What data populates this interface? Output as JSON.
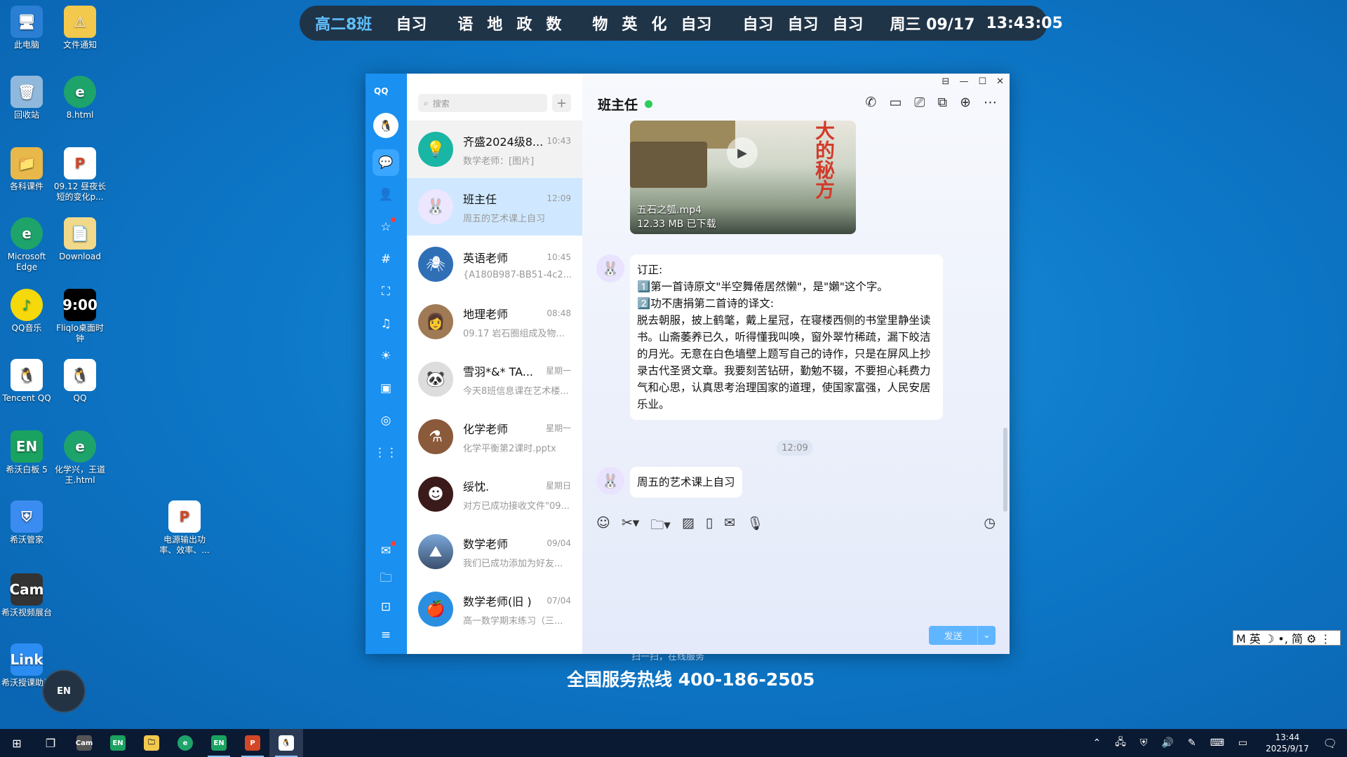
{
  "desktop": {
    "icons": [
      {
        "label": "此电脑"
      },
      {
        "label": "文件通知"
      },
      {
        "label": "回收站"
      },
      {
        "label": "8.html"
      },
      {
        "label": "各科课件"
      },
      {
        "label": "09.12 昼夜长短的变化p..."
      },
      {
        "label": "Microsoft Edge"
      },
      {
        "label": "Download"
      },
      {
        "label": "QQ音乐"
      },
      {
        "label": "Fliqlo桌面时钟"
      },
      {
        "label": "Tencent QQ"
      },
      {
        "label": "QQ"
      },
      {
        "label": "希沃白板 5"
      },
      {
        "label": "化学兴，王道王.html"
      },
      {
        "label": "希沃管家"
      },
      {
        "label": "电源输出功率、效率、..."
      },
      {
        "label": "希沃视频展台"
      },
      {
        "label": "希沃授课助手"
      }
    ],
    "ad_hotline": "全国服务热线 400-186-2505",
    "ad_small": "扫一扫，在线服务",
    "fab_label": "EN"
  },
  "schedule": {
    "class_name": "高二8班",
    "subjects": [
      "自习",
      "语",
      "地",
      "政",
      "数",
      "物",
      "英",
      "化",
      "自习",
      "自习",
      "自习",
      "自习"
    ],
    "date": "周三 09/17",
    "time": "13:43:05"
  },
  "ime": {
    "text": "M 英 ☽ •, 简 ⚙ ⋮"
  },
  "qq": {
    "logo": "QQ",
    "search_placeholder": "搜索",
    "conversations": [
      {
        "name": "齐盛2024级8...",
        "time": "10:43",
        "message": "数学老师：[图片]"
      },
      {
        "name": "班主任",
        "time": "12:09",
        "message": "周五的艺术课上自习"
      },
      {
        "name": "英语老师",
        "time": "10:45",
        "message": "{A180B987-BB51-4c2..."
      },
      {
        "name": "地理老师",
        "time": "08:48",
        "message": "09.17 岩石圈组成及物..."
      },
      {
        "name": "雪羽*&* TA...",
        "time": "星期一",
        "message": "今天8班信息课在艺术楼..."
      },
      {
        "name": "化学老师",
        "time": "星期一",
        "message": "化学平衡第2课时.pptx"
      },
      {
        "name": "绥忱.",
        "time": "星期日",
        "message": "对方已成功接收文件\"09..."
      },
      {
        "name": "数学老师",
        "time": "09/04",
        "message": "我们已成功添加为好友..."
      },
      {
        "name": "数学老师(旧 )",
        "time": "07/04",
        "message": "高一数学期末练习（三..."
      }
    ],
    "chat": {
      "title": "班主任",
      "video": {
        "name": "五石之瓠.mp4",
        "size": "12.33 MB 已下载",
        "overlay": "大的秘方"
      },
      "message1": {
        "l1": "订正:",
        "l2": "1️⃣第一首诗原文\"半空舞倦居然懒\"，是\"嬾\"这个字。",
        "l3": "2️⃣功不唐捐第二首诗的译文:",
        "l4": "脱去朝服，披上鹤氅，戴上星冠，在寝楼西侧的书堂里静坐读书。山斋萎养已久，听得懂我叫唤，窗外翠竹稀疏，漏下皎洁的月光。无意在白色墙壁上题写自己的诗作，只是在屏风上抄录古代圣贤文章。我要刻苦钻研，勤勉不辍，不要担心耗费力气和心思，认真思考治理国家的道理，使国家富强，人民安居乐业。"
      },
      "timestamp": "12:09",
      "message2": "周五的艺术课上自习",
      "send_label": "发送"
    }
  },
  "taskbar": {
    "clock_time": "13:44",
    "clock_date": "2025/9/17"
  }
}
